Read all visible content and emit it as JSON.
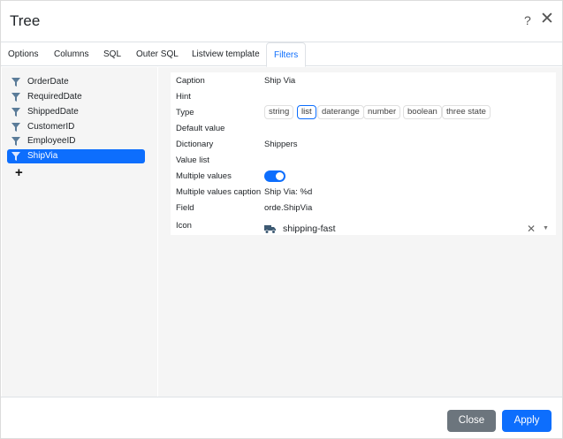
{
  "dialog": {
    "title": "Tree",
    "help_label": "?",
    "close_label": "✕"
  },
  "tabs": [
    {
      "label": "Options"
    },
    {
      "label": "Columns"
    },
    {
      "label": "SQL"
    },
    {
      "label": "Outer SQL"
    },
    {
      "label": "Listview template"
    },
    {
      "label": "Filters",
      "active": true
    }
  ],
  "sidebar": {
    "items": [
      {
        "label": "OrderDate"
      },
      {
        "label": "RequiredDate"
      },
      {
        "label": "ShippedDate"
      },
      {
        "label": "CustomerID"
      },
      {
        "label": "EmployeeID"
      },
      {
        "label": "ShipVia",
        "active": true
      }
    ],
    "add_label": "+"
  },
  "form": {
    "caption": {
      "label": "Caption",
      "value": "Ship Via"
    },
    "hint": {
      "label": "Hint",
      "value": ""
    },
    "type": {
      "label": "Type",
      "options": [
        "string",
        "list",
        "daterange",
        "number",
        "boolean",
        "three state"
      ],
      "selected": "list"
    },
    "default_value": {
      "label": "Default value",
      "value": ""
    },
    "dictionary": {
      "label": "Dictionary",
      "value": "Shippers"
    },
    "value_list": {
      "label": "Value list",
      "value": ""
    },
    "multiple_values": {
      "label": "Multiple values",
      "value": true
    },
    "multiple_values_caption": {
      "label": "Multiple values caption",
      "value": "Ship Via: %d"
    },
    "field": {
      "label": "Field",
      "value": "orde.ShipVia"
    },
    "icon": {
      "label": "Icon",
      "value": "shipping-fast",
      "icon_name": "truck-icon"
    }
  },
  "footer": {
    "close_label": "Close",
    "apply_label": "Apply"
  },
  "colors": {
    "accent": "#0d6efd",
    "secondary": "#6c757d",
    "panel": "#f5f5f5",
    "filter_icon": "#5b7c99",
    "truck_icon": "#3d5a73"
  }
}
